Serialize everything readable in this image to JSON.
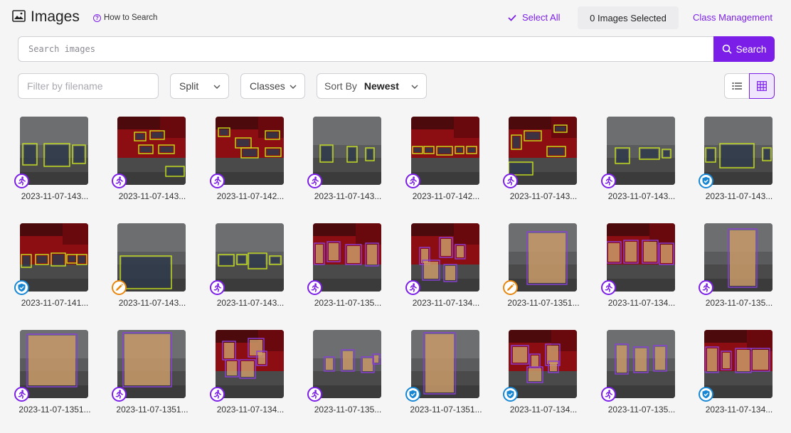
{
  "header": {
    "title": "Images",
    "how_to": "How to Search",
    "select_all": "Select All",
    "selected_count": "0 Images Selected",
    "class_management": "Class Management"
  },
  "search": {
    "placeholder": "Search images",
    "button": "Search"
  },
  "filters": {
    "filename_placeholder": "Filter by filename",
    "split": "Split",
    "classes": "Classes",
    "sort_by": "Sort By",
    "sort_value": "Newest"
  },
  "colors": {
    "accent": "#7b1fe8",
    "done": "#1787d4",
    "edit": "#e8870e",
    "box_elephant": "#c6e11f",
    "box_giraffe": "#8b3fd9"
  },
  "images": [
    {
      "name": "2023-11-07-143...",
      "status": "run",
      "scene": "gray",
      "subject": "elephant"
    },
    {
      "name": "2023-11-07-143...",
      "status": "run",
      "scene": "red",
      "subject": "elephant"
    },
    {
      "name": "2023-11-07-142...",
      "status": "run",
      "scene": "red",
      "subject": "elephant"
    },
    {
      "name": "2023-11-07-143...",
      "status": "run",
      "scene": "gray",
      "subject": "elephant"
    },
    {
      "name": "2023-11-07-142...",
      "status": "run",
      "scene": "red",
      "subject": "elephant"
    },
    {
      "name": "2023-11-07-143...",
      "status": "run",
      "scene": "red",
      "subject": "elephant"
    },
    {
      "name": "2023-11-07-143...",
      "status": "run",
      "scene": "gray",
      "subject": "elephant"
    },
    {
      "name": "2023-11-07-143...",
      "status": "done",
      "scene": "gray",
      "subject": "elephant"
    },
    {
      "name": "2023-11-07-141...",
      "status": "done",
      "scene": "red",
      "subject": "elephant"
    },
    {
      "name": "2023-11-07-143...",
      "status": "edit",
      "scene": "gray",
      "subject": "elephant"
    },
    {
      "name": "2023-11-07-143...",
      "status": "run",
      "scene": "gray",
      "subject": "elephant"
    },
    {
      "name": "2023-11-07-135...",
      "status": "run",
      "scene": "red",
      "subject": "giraffe"
    },
    {
      "name": "2023-11-07-134...",
      "status": "run",
      "scene": "red",
      "subject": "giraffe"
    },
    {
      "name": "2023-11-07-1351...",
      "status": "edit",
      "scene": "gray",
      "subject": "giraffe"
    },
    {
      "name": "2023-11-07-134...",
      "status": "run",
      "scene": "red",
      "subject": "giraffe"
    },
    {
      "name": "2023-11-07-135...",
      "status": "run",
      "scene": "gray",
      "subject": "giraffe"
    },
    {
      "name": "2023-11-07-1351...",
      "status": "run",
      "scene": "gray",
      "subject": "giraffe"
    },
    {
      "name": "2023-11-07-1351...",
      "status": "run",
      "scene": "gray",
      "subject": "giraffe"
    },
    {
      "name": "2023-11-07-134...",
      "status": "run",
      "scene": "red",
      "subject": "giraffe"
    },
    {
      "name": "2023-11-07-135...",
      "status": "run",
      "scene": "gray",
      "subject": "giraffe"
    },
    {
      "name": "2023-11-07-1351...",
      "status": "done",
      "scene": "gray",
      "subject": "giraffe"
    },
    {
      "name": "2023-11-07-134...",
      "status": "done",
      "scene": "red",
      "subject": "giraffe"
    },
    {
      "name": "2023-11-07-135...",
      "status": "run",
      "scene": "gray",
      "subject": "giraffe"
    },
    {
      "name": "2023-11-07-134...",
      "status": "done",
      "scene": "red",
      "subject": "giraffe"
    }
  ]
}
